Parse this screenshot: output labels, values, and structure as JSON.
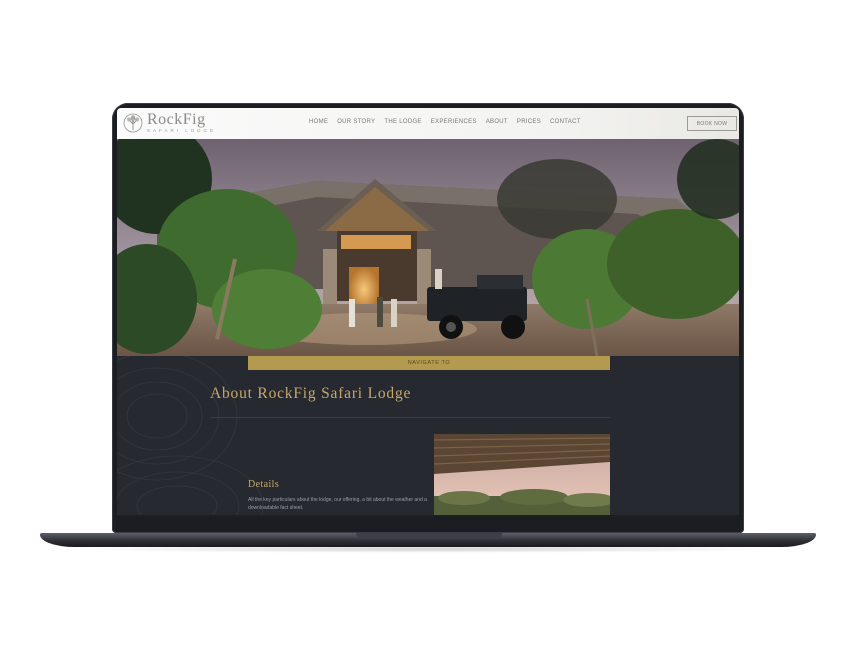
{
  "header": {
    "logo": "RockFig",
    "logo_sub": "SAFARI LODGE",
    "nav": [
      "HOME",
      "OUR STORY",
      "THE LODGE",
      "EXPERIENCES",
      "ABOUT",
      "PRICES",
      "CONTACT"
    ],
    "book_button": "BOOK NOW"
  },
  "hero": {
    "navigate_label": "NAVIGATE TO"
  },
  "about": {
    "title": "About RockFig Safari Lodge",
    "details_title": "Details",
    "details_text": "All the key particulars about the lodge, our offering, a bit about the weather and a downloadable fact sheet."
  },
  "colors": {
    "accent_gold": "#c7a86a",
    "nav_bar_gold": "#b39a4f",
    "dark_bg": "#262930"
  }
}
